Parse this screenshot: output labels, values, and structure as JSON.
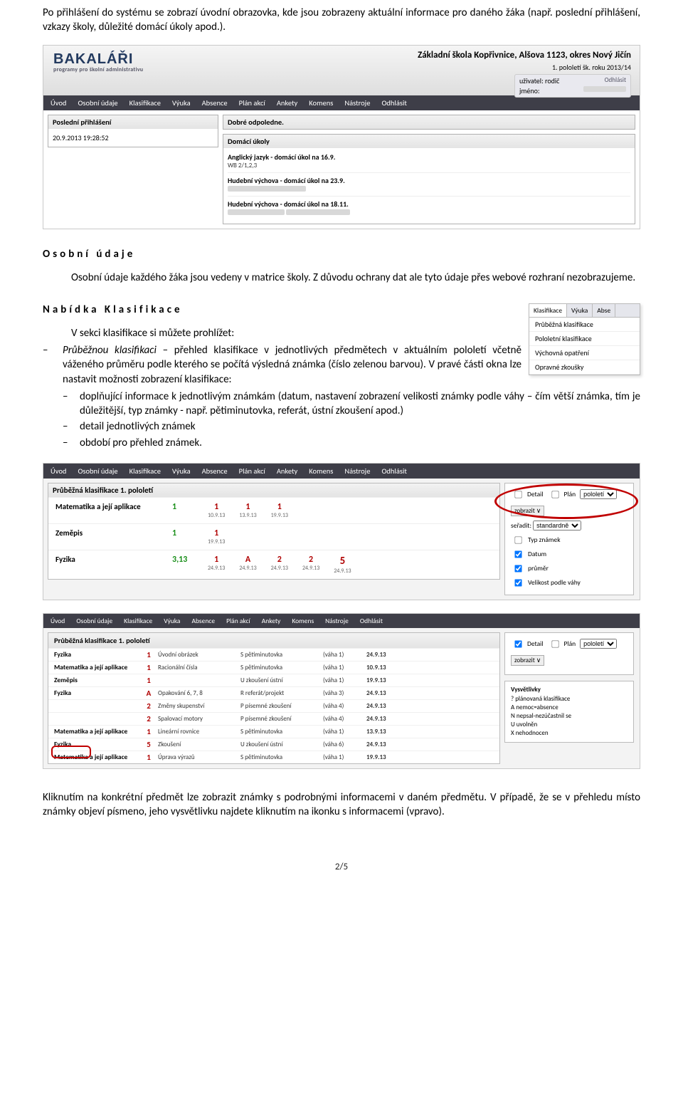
{
  "intro_p1": "Po přihlášení do systému se zobrazí úvodní obrazovka, kde jsou zobrazeny aktuální informace pro daného žáka (např. poslední přihlášení, vzkazy školy, důležité domácí úkoly apod.).",
  "shot1": {
    "logo_main": "BAKALÁŘI",
    "logo_sub": "programy pro školní administrativu",
    "school_title": "Základní škola Kopřivnice, Alšova 1123, okres Nový Jičín",
    "school_sub": "1. pololetí šk. roku 2013/14",
    "user_l1_label": "uživatel:",
    "user_l1_value": "rodič",
    "user_action": "Odhlásit",
    "user_l2_label": "jméno:",
    "menu": [
      "Úvod",
      "Osobní údaje",
      "Klasifikace",
      "Výuka",
      "Absence",
      "Plán akcí",
      "Ankety",
      "Komens",
      "Nástroje",
      "Odhlásit"
    ],
    "panel_login_h": "Poslední přihlášení",
    "panel_login_v": "20.9.2013 19:28:52",
    "panel_afternoon_h": "Dobré odpoledne.",
    "panel_hw_h": "Domácí úkoly",
    "hw": [
      {
        "t": "Anglický jazyk - domácí úkol na 16.9.",
        "s": "WB 2/1,2,3"
      },
      {
        "t": "Hudební výchova - domácí úkol na 23.9.",
        "s": ""
      },
      {
        "t": "Hudební výchova - domácí úkol na 18.11.",
        "s": ""
      }
    ]
  },
  "h_osobni": "Osobní  údaje",
  "p_osobni": "Osobní údaje každého žáka jsou vedeny v matrice školy. Z důvodu ochrany dat ale tyto údaje přes webové rozhraní nezobrazujeme.",
  "dropdown": {
    "tabs": [
      "Klasifikace",
      "Výuka",
      "Abse"
    ],
    "items": [
      "Průběžná klasifikace",
      "Pololetní klasifikace",
      "Výchovná opatření",
      "Opravné zkoušky"
    ]
  },
  "h_nabidka": "Nabídka  Klasifikace",
  "p_nabidka_intro": "V sekci klasifikace si můžete prohlížet:",
  "li1a": "Průběžnou klasifikaci",
  "li1b": " – přehled klasifikace v jednotlivých předmětech v aktuálním pololetí včetně váženého průměru podle kterého se počítá výsledná známka (číslo zelenou barvou). V pravé části okna lze nastavit možnosti zobrazení klasifikace:",
  "li2_1": "doplňující informace k jednotlivým známkám (datum, nastavení zobrazení velikosti známky podle váhy – čím větší známka, tím je důležitější, typ známky - např. pětiminutovka, referát, ústní zkoušení apod.)",
  "li2_2": "detail jednotlivých známek",
  "li2_3": "období pro přehled známek.",
  "shot2": {
    "menu": [
      "Úvod",
      "Osobní údaje",
      "Klasifikace",
      "Výuka",
      "Absence",
      "Plán akcí",
      "Ankety",
      "Komens",
      "Nástroje",
      "Odhlásit"
    ],
    "panel_title": "Průběžná klasifikace 1. pololetí",
    "subjects": [
      {
        "name": "Matematika a její aplikace",
        "avg": "1",
        "marks": [
          {
            "g": "1",
            "d": "10.9.13"
          },
          {
            "g": "1",
            "d": "13.9.13"
          },
          {
            "g": "1",
            "d": "19.9.13"
          }
        ]
      },
      {
        "name": "Zeměpis",
        "avg": "1",
        "marks": [
          {
            "g": "1",
            "d": "19.9.13"
          }
        ]
      },
      {
        "name": "Fyzika",
        "avg": "3,13",
        "marks": [
          {
            "g": "1",
            "d": "24.9.13"
          },
          {
            "g": "A",
            "d": "24.9.13"
          },
          {
            "g": "2",
            "d": "24.9.13"
          },
          {
            "g": "2",
            "d": "24.9.13"
          },
          {
            "g": "5",
            "d": "24.9.13",
            "big": true
          }
        ]
      }
    ],
    "opts": {
      "chk_detail": "Detail",
      "chk_plan": "Plán",
      "sel_period": "pololetí",
      "btn_show": "zobrazit ∨",
      "sort_label": "seřadit:",
      "sel_sort": "standardně",
      "chk_typ": "Typ známek",
      "chk_datum": "Datum",
      "chk_prumer": "průměr",
      "chk_velikost": "Velikost podle váhy"
    }
  },
  "shot3": {
    "menu": [
      "Úvod",
      "Osobní údaje",
      "Klasifikace",
      "Výuka",
      "Absence",
      "Plán akcí",
      "Ankety",
      "Komens",
      "Nástroje",
      "Odhlásit"
    ],
    "panel_title": "Průběžná klasifikace 1. pololetí",
    "rows": [
      {
        "s": "Fyzika",
        "g": "1",
        "topic": "Úvodní obrázek",
        "tt": "S pětiminutovka",
        "w": "(váha 1)",
        "d": "24.9.13"
      },
      {
        "s": "Matematika a její aplikace",
        "g": "1",
        "topic": "Racionální čísla",
        "tt": "S pětiminutovka",
        "w": "(váha 1)",
        "d": "10.9.13"
      },
      {
        "s": "Zeměpis",
        "g": "1",
        "topic": "",
        "tt": "U zkoušení ústní",
        "w": "(váha 1)",
        "d": "19.9.13"
      },
      {
        "s": "Fyzika",
        "g": "A",
        "topic": "Opakování 6, 7, 8",
        "tt": "R referát/projekt",
        "w": "(váha 3)",
        "d": "24.9.13"
      },
      {
        "s": "",
        "g": "2",
        "topic": "Změny skupenství",
        "tt": "P písemné zkoušení",
        "w": "(váha 4)",
        "d": "24.9.13"
      },
      {
        "s": "",
        "g": "2",
        "topic": "Spalovací motory",
        "tt": "P písemné zkoušení",
        "w": "(váha 4)",
        "d": "24.9.13"
      },
      {
        "s": "Matematika a její aplikace",
        "g": "1",
        "topic": "Lineární rovnice",
        "tt": "S pětiminutovka",
        "w": "(váha 1)",
        "d": "13.9.13"
      },
      {
        "s": "Fyzika",
        "g": "5",
        "topic": "Zkoušení",
        "tt": "U zkoušení ústní",
        "w": "(váha 6)",
        "d": "24.9.13"
      },
      {
        "s": "Matematika a její aplikace",
        "g": "1",
        "topic": "Úprava výrazů",
        "tt": "S pětiminutovka",
        "w": "(váha 1)",
        "d": "19.9.13"
      }
    ],
    "opts": {
      "chk_detail": "Detail",
      "chk_plan": "Plán",
      "sel_period": "pololetí",
      "btn_show": "zobrazit ∨"
    },
    "legend": {
      "title": "Vysvětlivky",
      "items": [
        "?  plánovaná klasifikace",
        "A  nemoc=absence",
        "N  nepsal-nezúčastnil se",
        "U  uvolněn",
        "X  nehodnocen"
      ]
    }
  },
  "p_footer": "Kliknutím na konkrétní předmět lze zobrazit známky s podrobnými informacemi v daném předmětu. V případě, že se v přehledu místo známky objeví písmeno, jeho vysvětlivku najdete kliknutím na ikonku s informacemi (vpravo).",
  "page_num": "2/5"
}
